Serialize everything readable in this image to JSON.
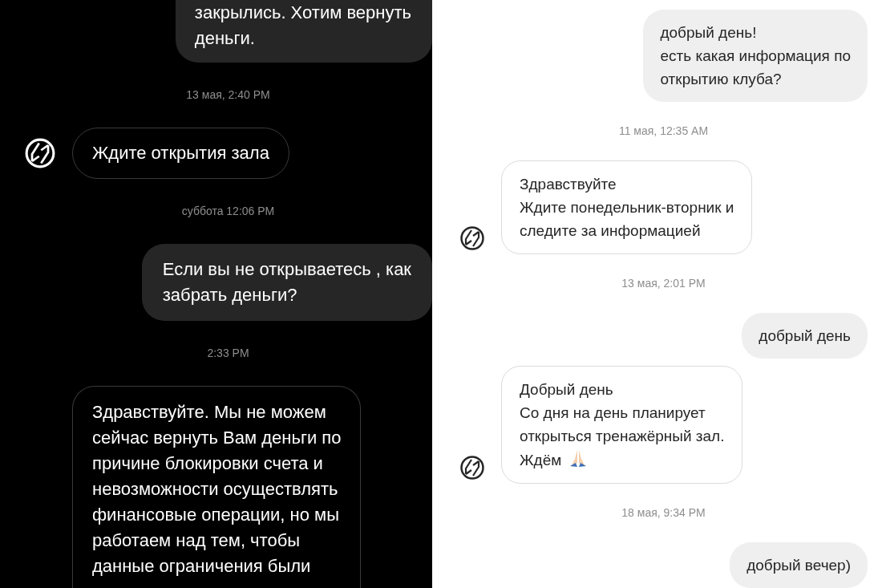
{
  "panels": [
    {
      "kind": "dark",
      "messages": [
        {
          "kind": "outgoing",
          "text": "закрылись. Хотим вернуть\nденьги."
        },
        {
          "kind": "timestamp",
          "text": "13 мая, 2:40 PM"
        },
        {
          "kind": "incoming",
          "text": "Ждите открытия зала"
        },
        {
          "kind": "timestamp",
          "text": "суббота 12:06 PM"
        },
        {
          "kind": "outgoing",
          "text": "Если вы не открываетесь , как\nзабрать деньги?"
        },
        {
          "kind": "timestamp",
          "text": "2:33 PM"
        },
        {
          "kind": "incoming",
          "text": "Здравствуйте. Мы не можем\nсейчас вернуть Вам деньги по\nпричине блокировки счета и\nневозможности осуществлять\nфинансовые операции, но мы\nработаем над тем, чтобы\nданные ограничения были"
        }
      ]
    },
    {
      "kind": "light",
      "messages": [
        {
          "kind": "outgoing",
          "text": "добрый день!\nесть какая информация по\nоткрытию клуба?"
        },
        {
          "kind": "timestamp",
          "text": "11 мая, 12:35 AM"
        },
        {
          "kind": "incoming",
          "text": "Здравствуйте\nЖдите понедельник-вторник и\nследите за информацией"
        },
        {
          "kind": "timestamp",
          "text": "13 мая, 2:01 PM"
        },
        {
          "kind": "outgoing",
          "text": "добрый день"
        },
        {
          "kind": "incoming",
          "text": "Добрый день\nСо дня на день планирует\nоткрыться тренажёрный зал.\nЖдём",
          "emoji": true
        },
        {
          "kind": "timestamp",
          "text": "18 мая, 9:34 PM"
        },
        {
          "kind": "outgoing",
          "text": "добрый вечер)"
        }
      ]
    }
  ]
}
